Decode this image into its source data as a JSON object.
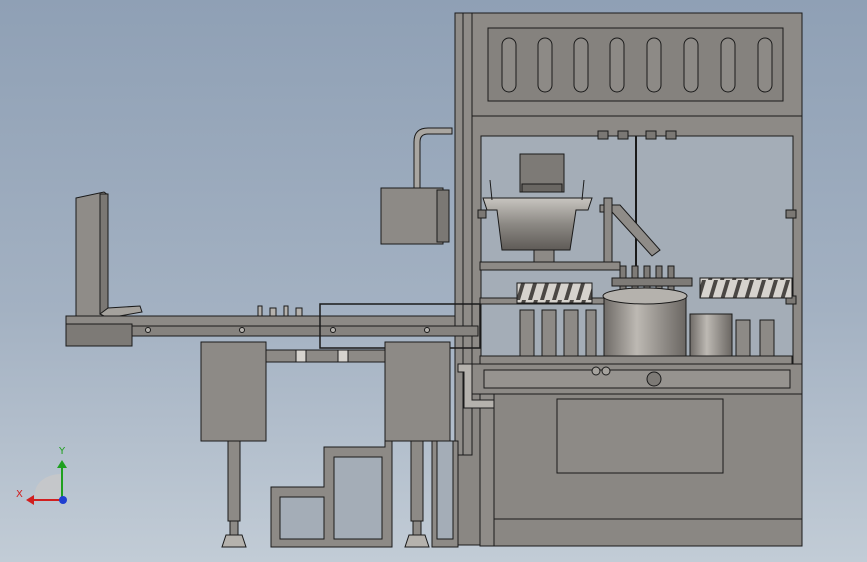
{
  "colors": {
    "background_top": "#8fa0b5",
    "background_bottom": "#c2ccd6",
    "metal": "#8d8a86",
    "metal_dark": "#5e5a57",
    "metal_light": "#b5b2ad",
    "outline": "#1a1a1a",
    "axis_x": "#d11f1f",
    "axis_y": "#1fa01f",
    "axis_z": "#1f3fd1"
  },
  "triad": {
    "x_label": "X",
    "y_label": "Y"
  }
}
